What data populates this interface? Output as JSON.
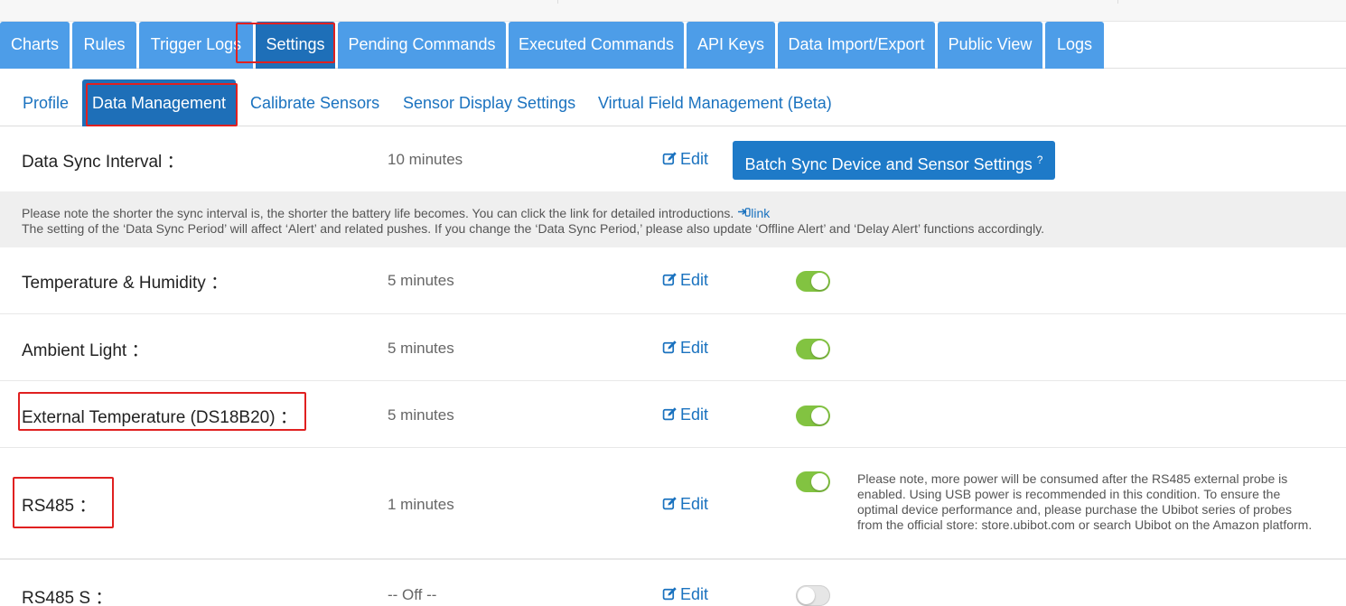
{
  "main_tabs": [
    {
      "label": "Charts"
    },
    {
      "label": "Rules"
    },
    {
      "label": "Trigger Logs"
    },
    {
      "label": "Settings"
    },
    {
      "label": "Pending Commands"
    },
    {
      "label": "Executed Commands"
    },
    {
      "label": "API Keys"
    },
    {
      "label": "Data Import/Export"
    },
    {
      "label": "Public View"
    },
    {
      "label": "Logs"
    }
  ],
  "sub_tabs": [
    {
      "label": "Profile"
    },
    {
      "label": "Data Management"
    },
    {
      "label": "Calibrate Sensors"
    },
    {
      "label": "Sensor Display Settings"
    },
    {
      "label": "Virtual Field Management (Beta)"
    }
  ],
  "sync": {
    "label": "Data Sync Interval ：",
    "value": "10 minutes",
    "edit_label": "Edit",
    "batch_button": "Batch Sync Device and Sensor Settings",
    "batch_help": "?"
  },
  "notice": {
    "line1": "Please note the shorter the sync interval is, the shorter the battery life becomes. You can click the link for detailed introductions.",
    "link_label": "link",
    "line2": "The setting of the ‘Data Sync Period’ will affect ‘Alert’ and related pushes. If you change the ‘Data Sync Period,’ please also update ‘Offline Alert’ and ‘Delay Alert’ functions accordingly."
  },
  "sensors": [
    {
      "label": "Temperature & Humidity ：",
      "value": "5 minutes",
      "edit_label": "Edit",
      "enabled": true
    },
    {
      "label": "Ambient Light ：",
      "value": "5 minutes",
      "edit_label": "Edit",
      "enabled": true
    },
    {
      "label": "External Temperature (DS18B20) ：",
      "value": "5 minutes",
      "edit_label": "Edit",
      "enabled": true
    },
    {
      "label": "RS485 ：",
      "value": "1 minutes",
      "edit_label": "Edit",
      "enabled": true,
      "note": "Please note, more power will be consumed after the RS485 external probe is enabled. Using USB power is recommended in this condition. To ensure the optimal device performance and, please purchase the Ubibot series of probes from the official store: store.ubibot.com or search Ubibot on the Amazon platform."
    },
    {
      "label": "RS485 S ：",
      "value": "-- Off --",
      "edit_label": "Edit",
      "enabled": false
    }
  ],
  "colors": {
    "tab_bg": "#4d9de8",
    "tab_active": "#1e6fb8",
    "link": "#1a72bf",
    "toggle_on": "#82c341",
    "highlight": "#e02020"
  }
}
